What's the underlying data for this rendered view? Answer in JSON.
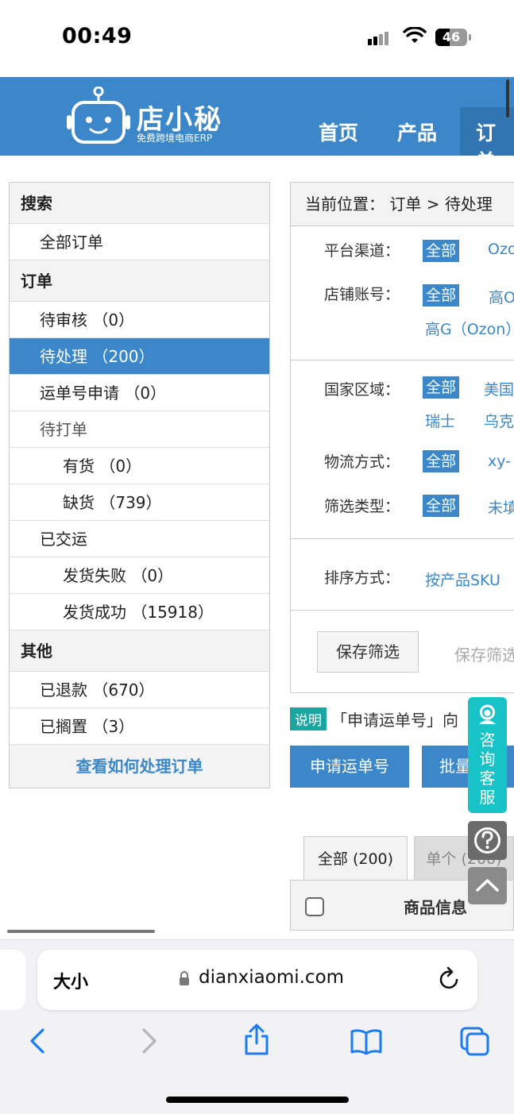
{
  "status_bar": {
    "time": "00:49",
    "battery": "46",
    "battery_level": 0.46
  },
  "site": {
    "brand": "店小秘",
    "tagline": "免费跨境电商ERP",
    "nav": {
      "home": "首页",
      "products": "产品",
      "orders": "订单"
    }
  },
  "sidebar": {
    "search_title": "搜索",
    "all_orders": "全部订单",
    "orders_title": "订单",
    "pending_review": "待审核 （0）",
    "pending_process": "待处理 （200）",
    "waybill_apply": "运单号申请 （0）",
    "to_print": "待打单",
    "in_stock": "有货 （0）",
    "out_of_stock": "缺货 （739）",
    "shipped": "已交运",
    "ship_failed": "发货失败 （0）",
    "ship_success": "发货成功 （15918）",
    "other_title": "其他",
    "refunded": "已退款 （670）",
    "on_hold": "已搁置 （3）",
    "help_link": "查看如何处理订单"
  },
  "panel": {
    "breadcrumb": "当前位置：  订单 > 待处理",
    "platform_label": "平台渠道：",
    "platform_all": "全部",
    "platform_opt1": "Ozo",
    "store_label": "店铺账号：",
    "store_all": "全部",
    "store_opt1": "高O",
    "store_opt2": "高G（Ozon）",
    "country_label": "国家区域：",
    "country_all": "全部",
    "country_opt1": "美国",
    "country_opt2": "瑞士",
    "country_opt3": "乌克",
    "logistics_label": "物流方式：",
    "logistics_all": "全部",
    "logistics_opt1": "xy-",
    "filter_type_label": "筛选类型：",
    "filter_type_all": "全部",
    "filter_type_opt1": "未填",
    "sort_label": "排序方式：",
    "sort_opt1": "按产品SKU",
    "save_filter": "保存筛选",
    "save_filter_alt": "保存筛选"
  },
  "note": {
    "badge": "说明",
    "text": "「申请运单号」向"
  },
  "actions": {
    "apply_waybill": "申请运单号",
    "batch": "批量"
  },
  "tabs": {
    "all": "全部 (200)",
    "single": "单个 (200)"
  },
  "table": {
    "col_product": "商品信息"
  },
  "float": {
    "consult": [
      "咨",
      "询",
      "客",
      "服"
    ]
  },
  "browser": {
    "text_size": "大小",
    "url": "dianxiaomi.com"
  },
  "colors": {
    "brand_blue": "#3b87c9",
    "teal": "#18c3c8"
  }
}
